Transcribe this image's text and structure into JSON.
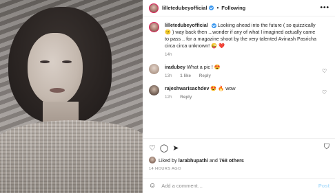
{
  "header": {
    "username": "lilletedubeyofficial",
    "separator": "•",
    "follow_label": "Following",
    "more": "•••"
  },
  "caption": {
    "username": "lilletedubeyofficial",
    "text": "Looking ahead into the future ( so quizzically 🙂 ) way back then ...wonder if any of what I imagined actually came to pass .. for a magazine shoot by the very talented Avinash Pasricha circa circa unknown! 😜 ❤️",
    "time": "14h"
  },
  "comments": [
    {
      "username": "iradubey",
      "text": "What a pic ! 😍",
      "time": "13h",
      "likes": "1 like",
      "reply": "Reply"
    },
    {
      "username": "rajeshwarisachdev",
      "text": "😍 🔥 wow",
      "time": "12h",
      "reply": "Reply"
    }
  ],
  "actions": {
    "liked_prefix": "Liked by",
    "liked_user": "larabhupathi",
    "liked_and": "and",
    "liked_others": "768 others",
    "timestamp": "14 HOURS AGO"
  },
  "add_comment": {
    "placeholder": "Add a comment…",
    "post_label": "Post"
  },
  "icons": {
    "heart": "heart-icon",
    "comment": "comment-icon",
    "share": "share-icon",
    "bookmark": "bookmark-icon",
    "smile": "emoji-icon"
  },
  "colors": {
    "verified": "#3897f0",
    "post_disabled": "#b2dffc",
    "heart_red": "#ed4956",
    "meta_gray": "#8e8e8e"
  }
}
